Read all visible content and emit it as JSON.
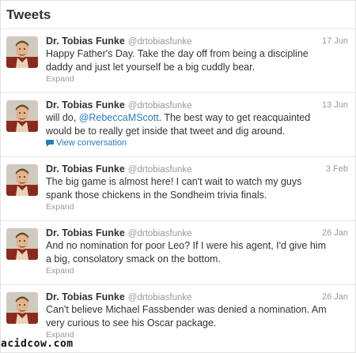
{
  "header": {
    "title": "Tweets"
  },
  "tweets": [
    {
      "name": "Dr. Tobias Funke",
      "handle": "@drtobiasfunke",
      "time": "17 Jun",
      "text_parts": [
        "Happy Father's Day. Take the day off from being a discipline daddy and just let yourself be a big cuddly bear."
      ],
      "action": "Expand"
    },
    {
      "name": "Dr. Tobias Funke",
      "handle": "@drtobiasfunke",
      "time": "13 Jun",
      "text_parts": [
        "will do, ",
        "@RebeccaMScott",
        ". The best way to get reacquainted would be to really get inside that tweet and dig around."
      ],
      "action": "View conversation"
    },
    {
      "name": "Dr. Tobias Funke",
      "handle": "@drtobiasfunke",
      "time": "3 Feb",
      "text_parts": [
        "The big game is almost here! I can't wait to watch my guys spank those chickens in the Sondheim trivia finals."
      ],
      "action": "Expand"
    },
    {
      "name": "Dr. Tobias Funke",
      "handle": "@drtobiasfunke",
      "time": "26 Jan",
      "text_parts": [
        "And no nomination for poor Leo? If I were his agent, I'd give him a big, consolatory smack on the bottom."
      ],
      "action": "Expand"
    },
    {
      "name": "Dr. Tobias Funke",
      "handle": "@drtobiasfunke",
      "time": "26 Jan",
      "text_parts": [
        "Can't believe Michael Fassbender was denied a nomination. Am very curious to see his Oscar package."
      ],
      "action": "Expand"
    }
  ],
  "watermark": "acidcow.com",
  "colors": {
    "link": "#2b7bb9",
    "muted": "#999999",
    "text": "#333333"
  },
  "icons": {
    "avatar": "avatar-image",
    "conversation": "speech-bubble-icon"
  }
}
